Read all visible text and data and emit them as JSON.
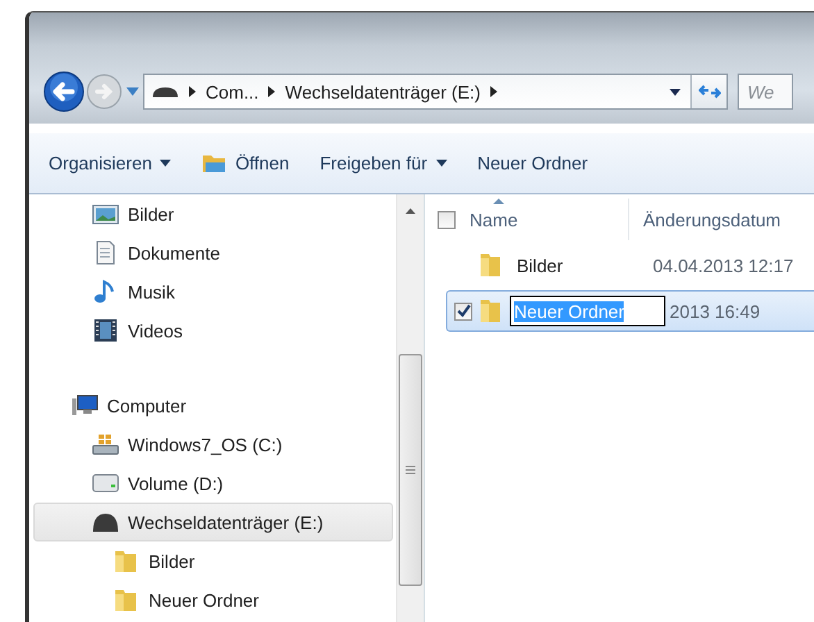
{
  "address_bar": {
    "segments": [
      {
        "label": "Com..."
      },
      {
        "label": "Wechseldatenträger (E:)"
      }
    ]
  },
  "search": {
    "placeholder": "We"
  },
  "toolbar": [
    {
      "label": "Organisieren",
      "dropdown": true,
      "kind": "plain"
    },
    {
      "label": "Öffnen",
      "dropdown": false,
      "kind": "open"
    },
    {
      "label": "Freigeben für",
      "dropdown": true,
      "kind": "plain"
    },
    {
      "label": "Neuer Ordner",
      "dropdown": false,
      "kind": "plain"
    }
  ],
  "library_items": [
    {
      "label": "Bilder",
      "kind": "pictures",
      "selected": false
    },
    {
      "label": "Dokumente",
      "kind": "documents",
      "selected": false
    },
    {
      "label": "Musik",
      "kind": "music",
      "selected": false
    },
    {
      "label": "Videos",
      "kind": "videos",
      "selected": false
    }
  ],
  "tree": [
    {
      "label": "Computer",
      "kind": "computer",
      "selected": false,
      "children": [
        {
          "label": "Windows7_OS (C:)",
          "kind": "system",
          "selected": false
        },
        {
          "label": "Volume (D:)",
          "kind": "drive",
          "selected": false
        },
        {
          "label": "Wechseldatenträger (E:)",
          "kind": "removable",
          "selected": true,
          "children": [
            {
              "label": "Bilder",
              "kind": "folder",
              "selected": false
            },
            {
              "label": "Neuer Ordner",
              "kind": "folder",
              "selected": false
            }
          ]
        }
      ]
    }
  ],
  "columns": [
    {
      "label": "Name",
      "sorted": true
    },
    {
      "label": "Änderungsdatum",
      "sorted": false
    }
  ],
  "select_all_checked": false,
  "rows": [
    {
      "name": "Bilder",
      "date": "04.04.2013 12:17",
      "checked": false,
      "selected": false,
      "editing": false
    },
    {
      "name": "Neuer Ordner",
      "date": "2013 16:49",
      "checked": true,
      "selected": true,
      "editing": true
    }
  ]
}
